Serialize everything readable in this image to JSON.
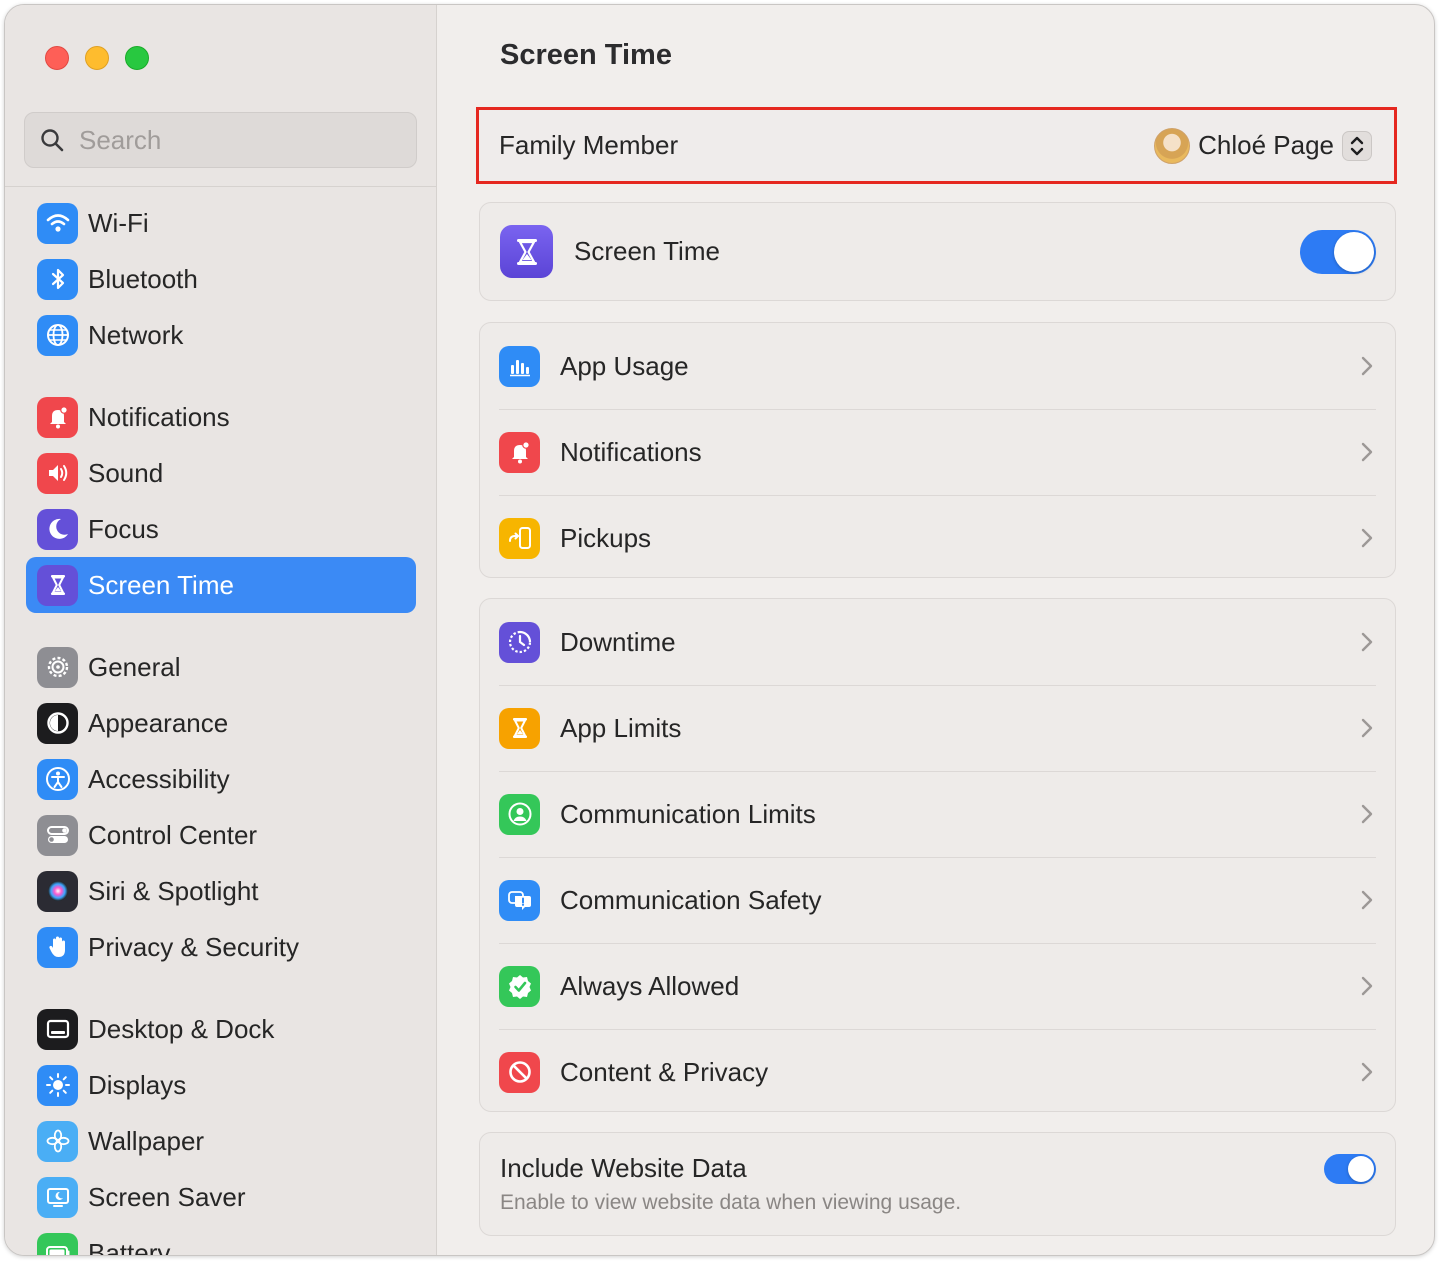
{
  "window": {
    "title": "Screen Time"
  },
  "search": {
    "placeholder": "Search"
  },
  "sidebar": {
    "items": [
      {
        "label": "Wi-Fi",
        "icon": "wifi-icon",
        "color": "#2f8cf6"
      },
      {
        "label": "Bluetooth",
        "icon": "bluetooth-icon",
        "color": "#2f8cf6"
      },
      {
        "label": "Network",
        "icon": "globe-icon",
        "color": "#2f8cf6"
      },
      {
        "label": "Notifications",
        "icon": "bell-icon",
        "color": "#f0474c"
      },
      {
        "label": "Sound",
        "icon": "speaker-icon",
        "color": "#f0474c"
      },
      {
        "label": "Focus",
        "icon": "moon-icon",
        "color": "#6450d8"
      },
      {
        "label": "Screen Time",
        "icon": "hourglass-icon",
        "color": "#6450d8",
        "selected": true
      },
      {
        "label": "General",
        "icon": "gear-icon",
        "color": "#8e8e93"
      },
      {
        "label": "Appearance",
        "icon": "appearance-icon",
        "color": "#1c1c1e"
      },
      {
        "label": "Accessibility",
        "icon": "accessibility-icon",
        "color": "#2f8cf6"
      },
      {
        "label": "Control Center",
        "icon": "control-center-icon",
        "color": "#8e8e93"
      },
      {
        "label": "Siri & Spotlight",
        "icon": "siri-icon",
        "color": "#2b2b33"
      },
      {
        "label": "Privacy & Security",
        "icon": "hand-icon",
        "color": "#2f8cf6"
      },
      {
        "label": "Desktop & Dock",
        "icon": "dock-icon",
        "color": "#1c1c1e"
      },
      {
        "label": "Displays",
        "icon": "sun-icon",
        "color": "#2f8cf6"
      },
      {
        "label": "Wallpaper",
        "icon": "flower-icon",
        "color": "#4aaef5"
      },
      {
        "label": "Screen Saver",
        "icon": "screensaver-icon",
        "color": "#4aaef5"
      },
      {
        "label": "Battery",
        "icon": "battery-icon",
        "color": "#34c759"
      }
    ]
  },
  "main": {
    "title": "Screen Time",
    "family_member": {
      "label": "Family Member",
      "selected": "Chloé Page"
    },
    "screen_time_toggle": {
      "label": "Screen Time",
      "on": true
    },
    "usage_group": [
      {
        "label": "App Usage",
        "icon": "app-usage-icon",
        "color": "#2f8cf6"
      },
      {
        "label": "Notifications",
        "icon": "notifications-icon",
        "color": "#f0474c"
      },
      {
        "label": "Pickups",
        "icon": "pickups-icon",
        "color": "#f7b500"
      }
    ],
    "limits_group": [
      {
        "label": "Downtime",
        "icon": "downtime-icon",
        "color": "#6450d8"
      },
      {
        "label": "App Limits",
        "icon": "app-limits-icon",
        "color": "#f7a200"
      },
      {
        "label": "Communication Limits",
        "icon": "communication-limits-icon",
        "color": "#34c759"
      },
      {
        "label": "Communication Safety",
        "icon": "communication-safety-icon",
        "color": "#2f8cf6"
      },
      {
        "label": "Always Allowed",
        "icon": "always-allowed-icon",
        "color": "#34c759"
      },
      {
        "label": "Content & Privacy",
        "icon": "content-privacy-icon",
        "color": "#f0474c"
      }
    ],
    "website_data": {
      "label": "Include Website Data",
      "description": "Enable to view website data when viewing usage.",
      "on": true
    }
  }
}
